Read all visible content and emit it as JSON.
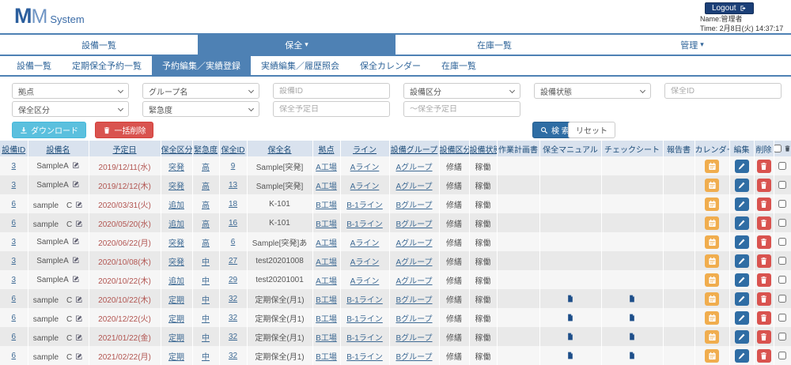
{
  "colors": {
    "accent_blue": "#4e81b4",
    "nav_text": "#2f6499",
    "table_header_bg": "#d9e2ee",
    "table_header_text": "#1e4d79",
    "link": "#3e6a94",
    "date_red": "#b25551",
    "calendar_btn": "#f0ad4e",
    "edit_btn": "#2f6da4",
    "delete_btn": "#d9534f",
    "download_btn": "#5bc0de",
    "search_btn": "#2e6da4",
    "logout_btn": "#1b3f77"
  },
  "header": {
    "logo_m1": "M",
    "logo_m2": "M",
    "logo_suffix": "System",
    "logout_label": "Logout",
    "user_label": "Name:管理者",
    "time_label": "Time: 2月8日(火) 14:37:17"
  },
  "main_nav": {
    "items": [
      {
        "label": "設備一覧",
        "caret": false,
        "active": false
      },
      {
        "label": "保全",
        "caret": true,
        "active": true
      },
      {
        "label": "在庫一覧",
        "caret": false,
        "active": false
      },
      {
        "label": "管理",
        "caret": true,
        "active": false
      }
    ]
  },
  "sub_nav": {
    "items": [
      {
        "label": "設備一覧",
        "active": false
      },
      {
        "label": "定期保全予約一覧",
        "active": false
      },
      {
        "label": "予約編集／実績登録",
        "active": true
      },
      {
        "label": "実績編集／履歴照会",
        "active": false
      },
      {
        "label": "保全カレンダー",
        "active": false
      },
      {
        "label": "在庫一覧",
        "active": false
      }
    ]
  },
  "filters": {
    "row1": [
      {
        "type": "select",
        "name": "site",
        "label": "拠点"
      },
      {
        "type": "select",
        "name": "group-name",
        "label": "グループ名"
      },
      {
        "type": "input",
        "name": "equip-id",
        "placeholder": "設備ID"
      },
      {
        "type": "select",
        "name": "equip-class",
        "label": "設備区分"
      },
      {
        "type": "select",
        "name": "equip-status",
        "label": "設備状態"
      },
      {
        "type": "input",
        "name": "maint-id",
        "placeholder": "保全ID"
      }
    ],
    "row2": [
      {
        "type": "select",
        "name": "maint-category",
        "label": "保全区分"
      },
      {
        "type": "select",
        "name": "urgency",
        "label": "緊急度"
      },
      {
        "type": "input",
        "name": "date-from",
        "placeholder": "保全予定日"
      },
      {
        "type": "input",
        "name": "date-to",
        "placeholder": "～保全予定日"
      }
    ]
  },
  "actions": {
    "download": "ダウンロード",
    "bulk_delete": "一括削除",
    "search": "検 索",
    "reset": "リセット"
  },
  "table": {
    "columns": [
      {
        "label": "設備ID",
        "key": "equip_id",
        "type": "link",
        "sortable": true,
        "width": 35
      },
      {
        "label": "設備名",
        "key": "equip_name",
        "type": "name_edit",
        "sortable": true,
        "width": 77
      },
      {
        "label": "予定日",
        "key": "scheduled_date",
        "type": "date",
        "sortable": true,
        "width": 91
      },
      {
        "label": "保全区分",
        "key": "category",
        "type": "link",
        "sortable": true,
        "width": 40
      },
      {
        "label": "緊急度",
        "key": "urgency",
        "type": "link",
        "sortable": true,
        "width": 34
      },
      {
        "label": "保全ID",
        "key": "maint_id",
        "type": "link",
        "sortable": true,
        "width": 35
      },
      {
        "label": "保全名",
        "key": "maint_name",
        "type": "text",
        "sortable": true,
        "width": 83
      },
      {
        "label": "拠点",
        "key": "site",
        "type": "link",
        "sortable": true,
        "width": 35
      },
      {
        "label": "ライン",
        "key": "line",
        "type": "link",
        "sortable": true,
        "width": 62
      },
      {
        "label": "設備グループ",
        "key": "group",
        "type": "link",
        "sortable": true,
        "width": 63
      },
      {
        "label": "設備区分",
        "key": "equip_class",
        "type": "text",
        "sortable": true,
        "width": 38
      },
      {
        "label": "設備状態",
        "key": "equip_status",
        "type": "text",
        "sortable": true,
        "width": 35
      },
      {
        "label": "作業計画書",
        "key": "plan_doc",
        "type": "doc",
        "sortable": false,
        "width": 54
      },
      {
        "label": "保全マニュアル",
        "key": "manual_doc",
        "type": "doc",
        "sortable": false,
        "width": 78
      },
      {
        "label": "チェックシート",
        "key": "checksheet_doc",
        "type": "doc",
        "sortable": false,
        "width": 78
      },
      {
        "label": "報告書",
        "key": "report_doc",
        "type": "doc",
        "sortable": false,
        "width": 40
      },
      {
        "label": "カレンダー",
        "key": "calendar",
        "type": "btn-calendar",
        "sortable": false,
        "width": 44
      },
      {
        "label": "編集",
        "key": "edit",
        "type": "btn-edit",
        "sortable": false,
        "width": 31
      },
      {
        "label": "削除",
        "key": "delete",
        "type": "btn-delete",
        "sortable": false,
        "width": 25
      },
      {
        "label": "",
        "key": "select",
        "type": "checkbox",
        "sortable": false,
        "width": 22
      }
    ],
    "rows": [
      {
        "equip_id": "3",
        "equip_name": "SampleA",
        "scheduled_date": "2019/12/11(水)",
        "category": "突発",
        "urgency": "高",
        "maint_id": "9",
        "maint_name": "Sample[突発]",
        "site": "A工場",
        "line": "Aライン",
        "group": "Aグループ",
        "equip_class": "修繕",
        "equip_status": "稼働",
        "plan_doc": false,
        "manual_doc": false,
        "checksheet_doc": false,
        "report_doc": false
      },
      {
        "equip_id": "3",
        "equip_name": "SampleA",
        "scheduled_date": "2019/12/12(木)",
        "category": "突発",
        "urgency": "高",
        "maint_id": "13",
        "maint_name": "Sample[突発]",
        "site": "A工場",
        "line": "Aライン",
        "group": "Aグループ",
        "equip_class": "修繕",
        "equip_status": "稼働",
        "plan_doc": false,
        "manual_doc": false,
        "checksheet_doc": false,
        "report_doc": false
      },
      {
        "equip_id": "6",
        "equip_name": "sample　C",
        "scheduled_date": "2020/03/31(火)",
        "category": "追加",
        "urgency": "高",
        "maint_id": "18",
        "maint_name": "K-101",
        "site": "B工場",
        "line": "B-1ライン",
        "group": "Bグループ",
        "equip_class": "修繕",
        "equip_status": "稼働",
        "plan_doc": false,
        "manual_doc": false,
        "checksheet_doc": false,
        "report_doc": false
      },
      {
        "equip_id": "6",
        "equip_name": "sample　C",
        "scheduled_date": "2020/05/20(水)",
        "category": "追加",
        "urgency": "高",
        "maint_id": "16",
        "maint_name": "K-101",
        "site": "B工場",
        "line": "B-1ライン",
        "group": "Bグループ",
        "equip_class": "修繕",
        "equip_status": "稼働",
        "plan_doc": false,
        "manual_doc": false,
        "checksheet_doc": false,
        "report_doc": false
      },
      {
        "equip_id": "3",
        "equip_name": "SampleA",
        "scheduled_date": "2020/06/22(月)",
        "category": "突発",
        "urgency": "高",
        "maint_id": "6",
        "maint_name": "Sample[突発]あ",
        "site": "A工場",
        "line": "Aライン",
        "group": "Aグループ",
        "equip_class": "修繕",
        "equip_status": "稼働",
        "plan_doc": false,
        "manual_doc": false,
        "checksheet_doc": false,
        "report_doc": false
      },
      {
        "equip_id": "3",
        "equip_name": "SampleA",
        "scheduled_date": "2020/10/08(木)",
        "category": "突発",
        "urgency": "中",
        "maint_id": "27",
        "maint_name": "test20201008",
        "site": "A工場",
        "line": "Aライン",
        "group": "Aグループ",
        "equip_class": "修繕",
        "equip_status": "稼働",
        "plan_doc": false,
        "manual_doc": false,
        "checksheet_doc": false,
        "report_doc": false
      },
      {
        "equip_id": "3",
        "equip_name": "SampleA",
        "scheduled_date": "2020/10/22(木)",
        "category": "追加",
        "urgency": "中",
        "maint_id": "29",
        "maint_name": "test20201001",
        "site": "A工場",
        "line": "Aライン",
        "group": "Aグループ",
        "equip_class": "修繕",
        "equip_status": "稼働",
        "plan_doc": false,
        "manual_doc": false,
        "checksheet_doc": false,
        "report_doc": false
      },
      {
        "equip_id": "6",
        "equip_name": "sample　C",
        "scheduled_date": "2020/10/22(木)",
        "category": "定期",
        "urgency": "中",
        "maint_id": "32",
        "maint_name": "定期保全(月1)",
        "site": "B工場",
        "line": "B-1ライン",
        "group": "Bグループ",
        "equip_class": "修繕",
        "equip_status": "稼働",
        "plan_doc": false,
        "manual_doc": true,
        "checksheet_doc": true,
        "report_doc": false
      },
      {
        "equip_id": "6",
        "equip_name": "sample　C",
        "scheduled_date": "2020/12/22(火)",
        "category": "定期",
        "urgency": "中",
        "maint_id": "32",
        "maint_name": "定期保全(月1)",
        "site": "B工場",
        "line": "B-1ライン",
        "group": "Bグループ",
        "equip_class": "修繕",
        "equip_status": "稼働",
        "plan_doc": false,
        "manual_doc": true,
        "checksheet_doc": true,
        "report_doc": false
      },
      {
        "equip_id": "6",
        "equip_name": "sample　C",
        "scheduled_date": "2021/01/22(金)",
        "category": "定期",
        "urgency": "中",
        "maint_id": "32",
        "maint_name": "定期保全(月1)",
        "site": "B工場",
        "line": "B-1ライン",
        "group": "Bグループ",
        "equip_class": "修繕",
        "equip_status": "稼働",
        "plan_doc": false,
        "manual_doc": true,
        "checksheet_doc": true,
        "report_doc": false
      },
      {
        "equip_id": "6",
        "equip_name": "sample　C",
        "scheduled_date": "2021/02/22(月)",
        "category": "定期",
        "urgency": "中",
        "maint_id": "32",
        "maint_name": "定期保全(月1)",
        "site": "B工場",
        "line": "B-1ライン",
        "group": "Bグループ",
        "equip_class": "修繕",
        "equip_status": "稼働",
        "plan_doc": false,
        "manual_doc": true,
        "checksheet_doc": true,
        "report_doc": false
      }
    ]
  }
}
